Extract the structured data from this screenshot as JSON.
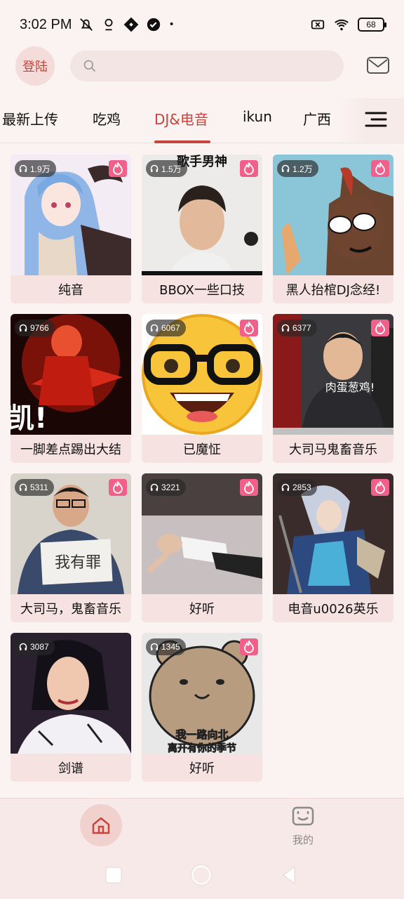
{
  "status_bar": {
    "time": "3:02 PM",
    "battery": "68",
    "icons": [
      "mute-icon",
      "location-icon",
      "app-icon",
      "check-icon",
      "wifi-icon",
      "sim-icon"
    ]
  },
  "header": {
    "login_label": "登陆",
    "search_placeholder": "",
    "mail_icon": "mail-icon"
  },
  "tabs": [
    {
      "label": "最新上传"
    },
    {
      "label": "吃鸡"
    },
    {
      "label": "DJ&电音",
      "active": true
    },
    {
      "label": "ikun"
    },
    {
      "label": "广西"
    }
  ],
  "cards": [
    {
      "title": "纯音",
      "plays": "1.9万"
    },
    {
      "title": "BBOX一些口技",
      "plays": "1.5万"
    },
    {
      "title": "黑人抬棺DJ念经!",
      "plays": "1.2万"
    },
    {
      "title": "一脚差点踢出大结",
      "plays": "9766"
    },
    {
      "title": "已魔怔",
      "plays": "6067"
    },
    {
      "title": "大司马鬼畜音乐",
      "plays": "6377"
    },
    {
      "title": "大司马，鬼畜音乐",
      "plays": "5311"
    },
    {
      "title": "好听",
      "plays": "3221"
    },
    {
      "title": "电音u0026英乐",
      "plays": "2853"
    },
    {
      "title": "剑谱",
      "plays": "3087"
    },
    {
      "title": "好听",
      "plays": "1345"
    }
  ],
  "thumb_texts": {
    "bbox_caption": "歌手男神",
    "kick_caption": "凯!",
    "streamer_caption": "肉蛋葱鸡!",
    "sign_caption": "我有罪",
    "bear_line1": "我一路向北",
    "bear_line2": "离开有你的季节"
  },
  "bottom_nav": {
    "mine_label": "我的"
  },
  "colors": {
    "accent": "#c8443c",
    "hot_badge": "#f0608a",
    "background": "#fbf3f2"
  }
}
